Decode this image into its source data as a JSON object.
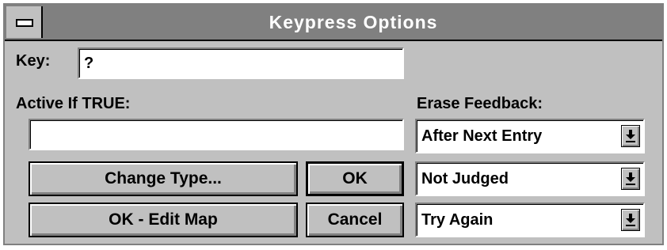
{
  "window": {
    "title": "Keypress Options"
  },
  "key": {
    "label": "Key:",
    "value": "?"
  },
  "active_if": {
    "label": "Active If TRUE:",
    "value": ""
  },
  "erase_feedback": {
    "label": "Erase Feedback:",
    "selected": "After Next Entry"
  },
  "judging": {
    "selected": "Not Judged"
  },
  "retry": {
    "selected": "Try Again"
  },
  "buttons": {
    "change_type": "Change Type...",
    "ok": "OK",
    "ok_edit_map": "OK - Edit Map",
    "cancel": "Cancel"
  },
  "colors": {
    "face": "#c0c0c0",
    "titlebar": "#808080",
    "title_text": "#ffffff",
    "field": "#ffffff"
  },
  "icons": {
    "system_menu": "system-menu-icon",
    "dropdown": "dropdown-arrow-icon"
  }
}
